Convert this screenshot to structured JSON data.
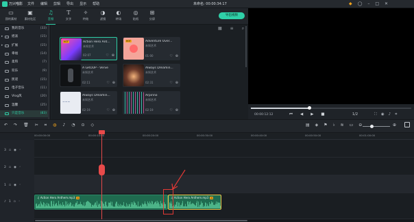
{
  "app": {
    "name": "万兴喵影",
    "project_title": "未命名: 00:00:34:17"
  },
  "menu": [
    "文件",
    "编辑",
    "剪辑",
    "导出",
    "显示",
    "帮助"
  ],
  "window_icons": [
    "gift-icon",
    "account-icon",
    "minimize-icon",
    "maximize-icon",
    "close-icon"
  ],
  "toolbar": {
    "tools": [
      {
        "label": "我的素材",
        "icon": "folder-icon"
      },
      {
        "label": "素材社区",
        "icon": "image-icon"
      },
      {
        "label": "音频",
        "icon": "music-note-icon",
        "active": true
      },
      {
        "label": "文字",
        "icon": "text-icon"
      },
      {
        "label": "特效",
        "icon": "magic-icon"
      },
      {
        "label": "滤镜",
        "icon": "filter-icon"
      },
      {
        "label": "转场",
        "icon": "transition-icon"
      },
      {
        "label": "贴纸",
        "icon": "sticker-icon"
      },
      {
        "label": "分屏",
        "icon": "split-screen-icon"
      }
    ],
    "export_label": "导出视频"
  },
  "sidebar": {
    "categories": [
      {
        "label": "我的音乐",
        "count": "(33)"
      },
      {
        "label": "摇滚",
        "count": "(15)",
        "expandable": true
      },
      {
        "label": "扩展",
        "count": "(15)",
        "expandable": true
      },
      {
        "label": "幸福",
        "count": "(14)"
      },
      {
        "label": "柔和",
        "count": "(7)"
      },
      {
        "label": "欢乐",
        "count": "(9)"
      },
      {
        "label": "民谣",
        "count": "(15)"
      },
      {
        "label": "电子音乐",
        "count": "(11)"
      },
      {
        "label": "Vlog风",
        "count": "(20)"
      },
      {
        "label": "温馨",
        "count": "(25)"
      },
      {
        "label": "只是音乐",
        "count": "(83)",
        "selected": true
      }
    ]
  },
  "library": {
    "tool_icons": [
      "grid-view-icon",
      "filter-icon",
      "search-icon"
    ],
    "cards": [
      {
        "title": "Action Hero Ant...",
        "artist": "未知艺术",
        "duration": "02:07",
        "hot": true,
        "selected": true,
        "thumb": "pink-purple"
      },
      {
        "title": "Adventure Over...",
        "artist": "未知艺术",
        "duration": "01:00",
        "hot": true,
        "thumb": "pink-orb"
      },
      {
        "title": "A GROUP - Verve",
        "artist": "未知艺术",
        "duration": "02:11",
        "thumb": "dark-figure"
      },
      {
        "title": "Always Dreamin...",
        "artist": "未知艺术",
        "duration": "02:31",
        "thumb": "warm-light"
      },
      {
        "title": "Always Dreamin...",
        "artist": "未知艺术",
        "duration": "02:19",
        "thumb": "white-script"
      },
      {
        "title": "Arpinno",
        "artist": "未知艺术",
        "duration": "02:19",
        "thumb": "teal-lines"
      }
    ]
  },
  "player": {
    "progress": 0.37,
    "timecode": "00:00:12:12",
    "zoom": "1/2",
    "control_icons": [
      "prev-frame-icon",
      "rewind-icon",
      "play-icon",
      "stop-icon"
    ],
    "right_icons": [
      "fullscreen-icon",
      "snapshot-icon",
      "volume-icon",
      "crop-icon"
    ]
  },
  "timeline": {
    "left_tool_icons": [
      "undo-icon",
      "redo-icon",
      "delete-icon",
      "cut-icon",
      "crop-icon",
      "color-icon",
      "audio-icon",
      "speed-icon",
      "stabilize-icon",
      "keyframe-icon"
    ],
    "right_tool_icons": [
      "render-icon",
      "shield-icon",
      "marker-icon",
      "mic-icon",
      "voiceover-icon",
      "caption-icon",
      "zoom-out-icon"
    ],
    "zoom_level": 0.28,
    "ruler_ticks": [
      {
        "label": "00:00:00:00"
      },
      {
        "label": "00:00:10:00"
      },
      {
        "label": "00:00:20:00"
      },
      {
        "label": "00:00:30:00"
      },
      {
        "label": "00:00:40:00"
      },
      {
        "label": "00:00:50:00"
      },
      {
        "label": "00:01:00:00"
      }
    ],
    "track_labels": [
      "3",
      "2",
      "1",
      "1"
    ],
    "clips": [
      {
        "title": "Action Hero Anthem.mp3",
        "badge": "AI",
        "selected": false
      },
      {
        "title": "Action Hero Anthem.mp3",
        "badge": "AI",
        "selected": true
      }
    ]
  },
  "colors": {
    "accent": "#2fd0a8",
    "playhead": "#e84a4a",
    "clip": "#1f6b4f",
    "clip_selected": "#f2c94c",
    "annotation": "#e53935"
  }
}
